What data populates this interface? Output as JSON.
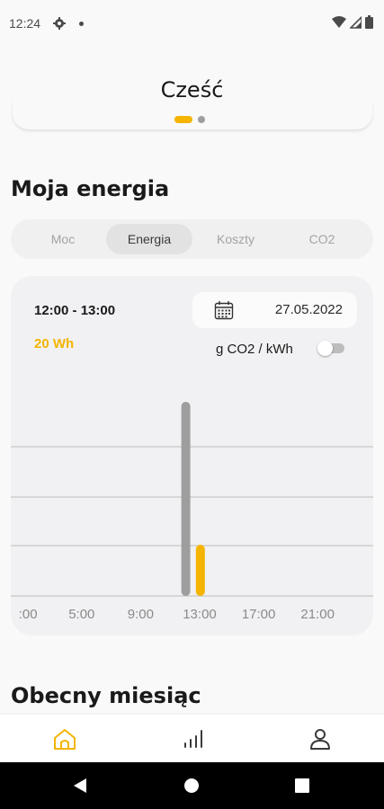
{
  "status_bar": {
    "time": "12:24",
    "icons": [
      "gear-icon",
      "notification-dot-icon",
      "wifi-icon",
      "signal-icon",
      "battery-icon"
    ]
  },
  "header": {
    "title": "Cześć"
  },
  "carousel": {
    "pages": 2,
    "active_index": 0
  },
  "energy_section": {
    "title": "Moja energia",
    "tabs": [
      {
        "label": "Moc",
        "active": false
      },
      {
        "label": "Energia",
        "active": true
      },
      {
        "label": "Koszty",
        "active": false
      },
      {
        "label": "CO2",
        "active": false
      }
    ]
  },
  "chart_card": {
    "time_range": "12:00 - 13:00",
    "value": "20 Wh",
    "date": "27.05.2022",
    "unit_toggle_label": "g CO2 / kWh",
    "unit_toggle_on": false
  },
  "chart_data": {
    "type": "bar",
    "x_tick_labels": [
      ":00",
      "5:00",
      "9:00",
      "13:00",
      "17:00",
      "21:00"
    ],
    "series": [
      {
        "color": "#9e9e9e",
        "x": [
          12
        ],
        "values": [
          1.0
        ]
      },
      {
        "color": "#f4b400",
        "x": [
          12.5
        ],
        "values": [
          0.25
        ]
      }
    ],
    "grid": true,
    "colors": {
      "accent": "#f4b400",
      "secondary": "#9e9e9e",
      "grid": "#c8c8c8"
    }
  },
  "month_section": {
    "title": "Obecny miesiąc"
  },
  "bottom_nav": {
    "items": [
      {
        "name": "home-icon",
        "active": true
      },
      {
        "name": "chart-icon",
        "active": false
      },
      {
        "name": "profile-icon",
        "active": false
      }
    ]
  },
  "colors": {
    "accent": "#f4b400",
    "background": "#f9f9f9",
    "card": "#f1f1f3",
    "text": "#1a1a1a"
  }
}
